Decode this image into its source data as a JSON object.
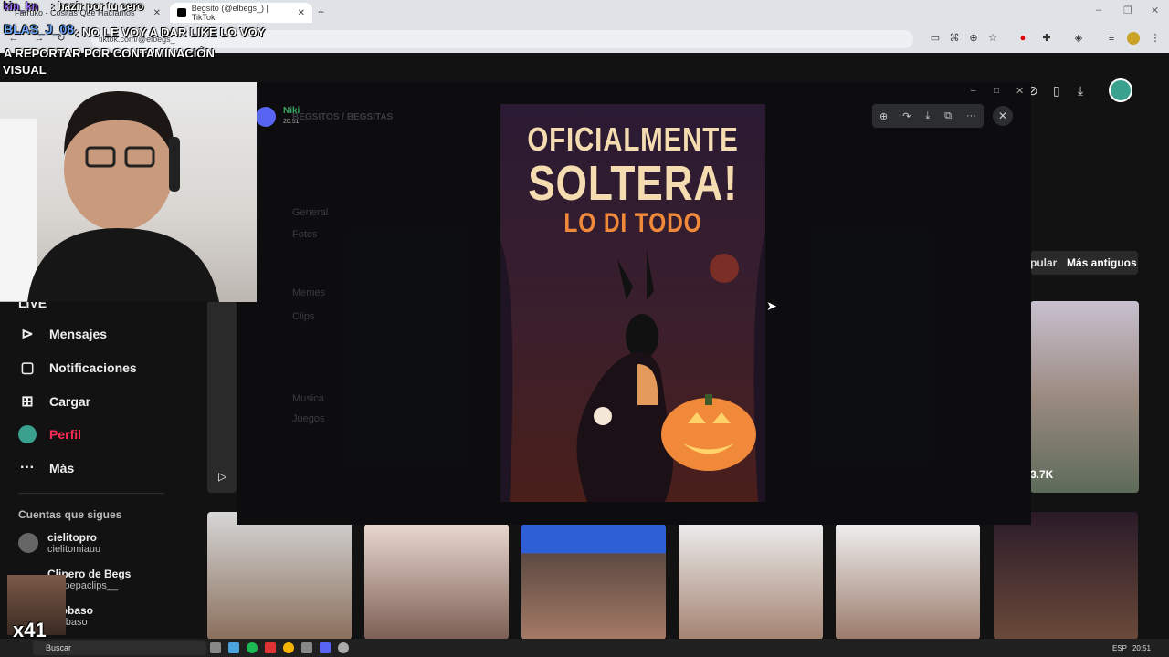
{
  "browser": {
    "tabs": [
      {
        "label": "Farruko - Cositas Que Hacíamos",
        "active": false
      },
      {
        "label": "Begsito (@elbegs_) | TikTok",
        "active": true
      }
    ],
    "new_tab": "+",
    "url": "tiktok.com/@elbegs_",
    "window_controls": [
      "–",
      "❐",
      "✕"
    ]
  },
  "overlays": {
    "chat_user1": "kin_kn",
    "chat_msg1": ": hazir por tu cero",
    "chat_user2": "BLAS_J_08",
    "chat_msg2": ": NO LE VOY A DAR LIKE LO VOY A REPORTAR POR CONTAMINACIÓN",
    "label_visual": "VISUAL",
    "multiplier": "x41"
  },
  "sidebar": {
    "live_partial": "LIVE",
    "items": [
      {
        "label": "Mensajes",
        "icon": "send-icon"
      },
      {
        "label": "Notificaciones",
        "icon": "inbox-icon"
      },
      {
        "label": "Cargar",
        "icon": "upload-plus-icon"
      },
      {
        "label": "Perfil",
        "icon": "avatar-icon"
      },
      {
        "label": "Más",
        "icon": "more-icon"
      }
    ],
    "following_header": "Cuentas que sigues",
    "accounts": [
      {
        "name": "cielitopro",
        "handle": "cielitomiauu"
      },
      {
        "name": "Clipero de Begs",
        "handle": "edepepaclips__"
      },
      {
        "name": "robaso",
        "handle": "robaso"
      }
    ]
  },
  "tiktok": {
    "sort_popular": "pular",
    "sort_oldest": "Más antiguos",
    "view_count": "3.7K"
  },
  "discord": {
    "user": "Niki",
    "time": "20:51",
    "server": "BEGSITOS / BEGSITAS",
    "channels": [
      "General",
      "Fotos",
      "Memes",
      "Clips",
      "Musica",
      "Juegos"
    ]
  },
  "poster": {
    "line1": "OFICIALMENTE",
    "line2": "SOLTERA!",
    "line3": "LO DI TODO"
  },
  "taskbar": {
    "search": "Buscar",
    "lang": "ESP",
    "time": "20:51"
  },
  "colors": {
    "accent_red": "#fe2c55",
    "discord_green": "#3ba55d",
    "poster_yellow": "#f4dcb0",
    "poster_orange": "#f08a3a"
  }
}
